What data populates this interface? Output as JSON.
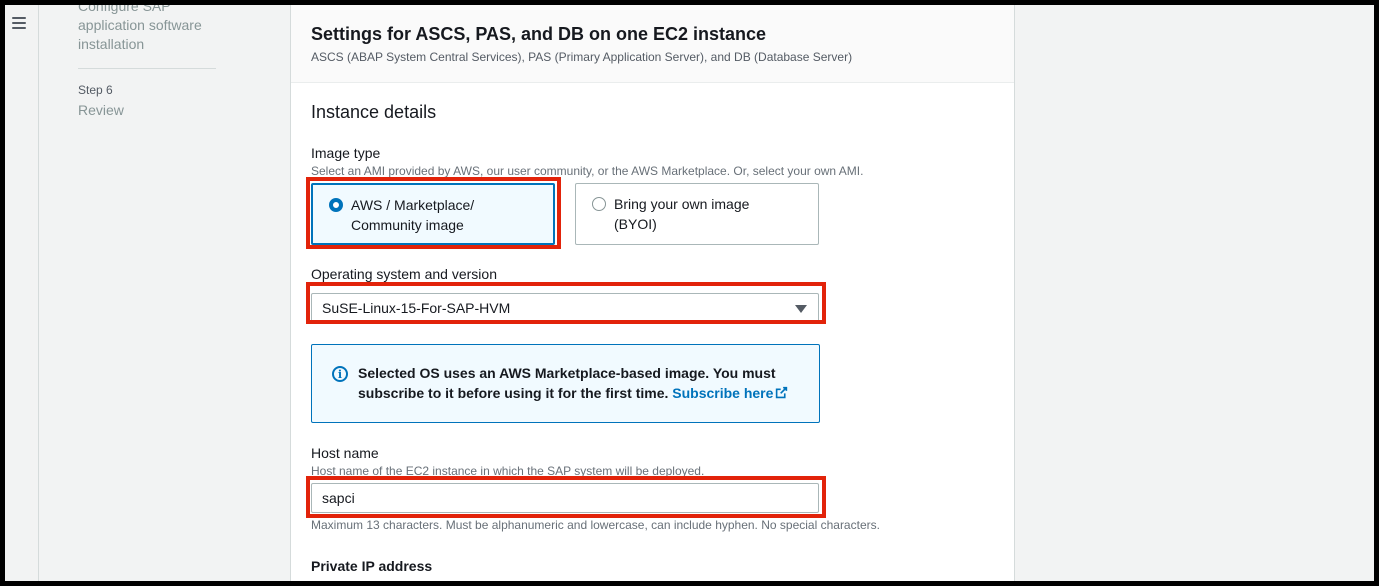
{
  "nav": {
    "prev_step_title": "Configure SAP application software installation",
    "step_label": "Step 6",
    "step_title": "Review"
  },
  "header": {
    "title": "Settings for ASCS, PAS, and DB on one EC2 instance",
    "subtitle": "ASCS (ABAP System Central Services), PAS (Primary Application Server), and DB (Database Server)"
  },
  "instance": {
    "section_title": "Instance details",
    "image_type": {
      "label": "Image type",
      "description": "Select an AMI provided by AWS, our user community, or the AWS Marketplace. Or, select your own AMI.",
      "options": [
        {
          "label": "AWS / Marketplace/ Community image",
          "selected": true
        },
        {
          "label": "Bring your own image (BYOI)",
          "selected": false
        }
      ]
    },
    "os": {
      "label": "Operating system and version",
      "value": "SuSE-Linux-15-For-SAP-HVM"
    },
    "alert": {
      "text": "Selected OS uses an AWS Marketplace-based image. You must subscribe to it before using it for the first time.",
      "link": "Subscribe here"
    },
    "hostname": {
      "label": "Host name",
      "description": "Host name of the EC2 instance in which the SAP system will be deployed.",
      "value": "sapci",
      "constraint": "Maximum 13 characters. Must be alphanumeric and lowercase, can include hyphen. No special characters."
    },
    "private_ip_label": "Private IP address"
  },
  "colors": {
    "accent": "#0073bb",
    "highlight": "#e2230a"
  }
}
